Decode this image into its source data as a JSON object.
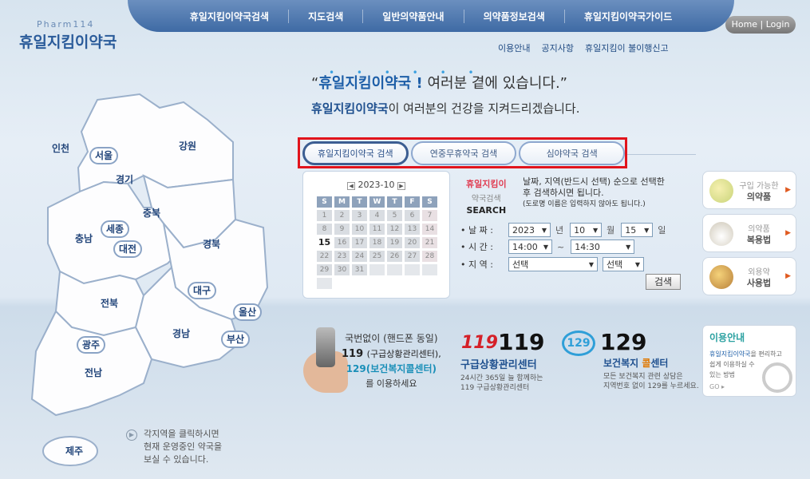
{
  "logo": {
    "small": "Pharm114",
    "big": "휴일지킴이약국"
  },
  "topnav": [
    "휴일지킴이약국검색",
    "지도검색",
    "일반의약품안내",
    "의약품정보검색",
    "휴일지킴이약국가이드"
  ],
  "home_login": "Home | Login",
  "subnav": [
    "이용안내",
    "공지사항",
    "휴일지킴이 불이행신고"
  ],
  "headline": {
    "quote_open": "“",
    "em1": "휴일지킴이약국 !",
    "rest1": " 여러분 곁에 있습니다.",
    "quote_close": "”",
    "em2": "휴일지킴이약국",
    "rest2": "이 여러분의 건강을 지켜드리겠습니다."
  },
  "tabs": [
    "휴일지킴이약국 검색",
    "연중무휴약국 검색",
    "심야약국 검색"
  ],
  "calendar": {
    "title": "2023-10",
    "weekdays": [
      "S",
      "M",
      "T",
      "W",
      "T",
      "F",
      "S"
    ],
    "days": [
      "1",
      "2",
      "3",
      "4",
      "5",
      "6",
      "7",
      "8",
      "9",
      "10",
      "11",
      "12",
      "13",
      "14",
      "15",
      "16",
      "17",
      "18",
      "19",
      "20",
      "21",
      "22",
      "23",
      "24",
      "25",
      "26",
      "27",
      "28",
      "29",
      "30",
      "31",
      "",
      "",
      "",
      "",
      ""
    ],
    "today": "15"
  },
  "search_form": {
    "title1": "휴일지킴이",
    "title2": "약국검색",
    "title3": "SEARCH",
    "desc1": "날짜, 지역(반드시 선택) 순으로 선택한",
    "desc2": "후 검색하시면 됩니다.",
    "desc3": "(도로명 이름은 입력하지 않아도 됩니다.)",
    "date_label": "• 날 짜 :",
    "year": "2023",
    "year_unit": "년",
    "month": "10",
    "month_unit": "월",
    "day": "15",
    "day_unit": "일",
    "time_label": "• 시 간 :",
    "time_from": "14:00",
    "time_sep": "~",
    "time_to": "14:30",
    "region_label": "• 지 역 :",
    "region1": "선택",
    "region2": "선택",
    "search_button": "검색"
  },
  "side_buttons": [
    {
      "line1": "구입 가능한",
      "line2": "의약품",
      "icon": "pill-icon"
    },
    {
      "line1": "의약품",
      "line2": "복용법",
      "icon": "mortar-icon"
    },
    {
      "line1": "외용약",
      "line2": "사용법",
      "icon": "ointment-icon"
    }
  ],
  "map": {
    "regions": [
      "인천",
      "서울",
      "경기",
      "강원",
      "충북",
      "세종",
      "충남",
      "대전",
      "경북",
      "대구",
      "전북",
      "울산",
      "경남",
      "광주",
      "부산",
      "전남",
      "제주"
    ],
    "hint": "각지역을 클릭하시면\n현재 운영중인 약국을\n보실 수 있습니다."
  },
  "info_phone": {
    "a": "국번없이 (핸드폰 동일)",
    "b": "119",
    "b_small": "(구급상황관리센터),",
    "c": "129(보건복지콜센터)",
    "d": "를 이용하세요"
  },
  "info_119": {
    "logo": "119",
    "number": "119",
    "title": "구급상황관리센터",
    "sub": "24시간 365일 늘 함께하는\n119 구급상황관리센터"
  },
  "info_129": {
    "logo": "129",
    "number": "129",
    "title_a": "보건복지 ",
    "title_hl": "콜",
    "title_b": "센터",
    "sub": "모든 보건복지 관련 상담은\n지역번호 없이 129를 누르세요."
  },
  "guide_box": {
    "title": "이용안내",
    "em": "휴일지킴이약국",
    "text": "을 편리하고\n쉽게 이용하실 수\n있는 방법",
    "go": "GO ▸"
  },
  "colors": {
    "accent": "#1e5fa8",
    "highlight_border": "#e1141c",
    "nav_blue": "#3e6aa4"
  }
}
